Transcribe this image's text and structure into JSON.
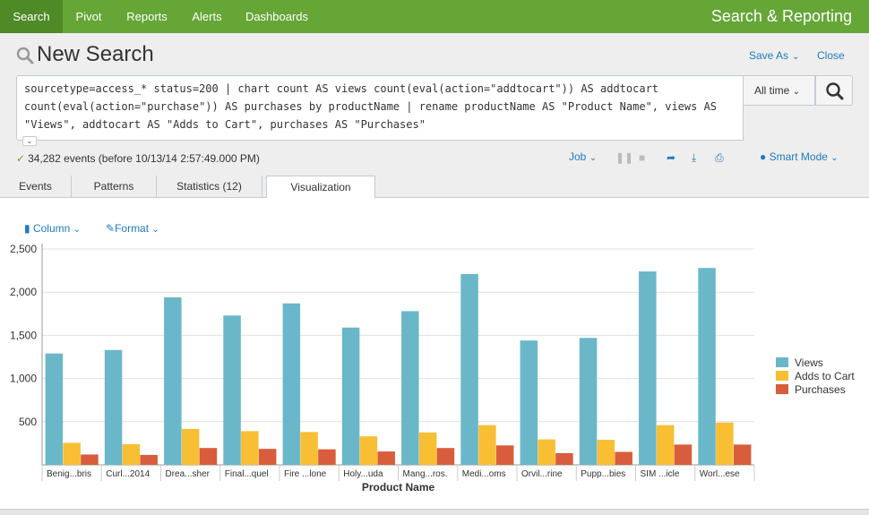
{
  "nav": {
    "items": [
      "Search",
      "Pivot",
      "Reports",
      "Alerts",
      "Dashboards"
    ],
    "active": "Search",
    "app_title": "Search & Reporting"
  },
  "header": {
    "title": "New Search",
    "save_as": "Save As",
    "close": "Close"
  },
  "search": {
    "query": "sourcetype=access_* status=200 | chart count AS views count(eval(action=\"addtocart\")) AS addtocart\ncount(eval(action=\"purchase\")) AS purchases by productName | rename productName AS \"Product Name\", views AS\n\"Views\", addtocart AS \"Adds to Cart\", purchases AS \"Purchases\"",
    "time_range": "All time"
  },
  "status": {
    "events": "34,282 events (before 10/13/14 2:57:49.000 PM)",
    "job": "Job",
    "mode": "Smart Mode"
  },
  "tabs": [
    "Events",
    "Patterns",
    "Statistics (12)",
    "Visualization"
  ],
  "active_tab": "Visualization",
  "viz_controls": {
    "type": "Column",
    "format": "Format"
  },
  "colors": {
    "nav_green": "#65a637",
    "link_blue": "#1e7ac2",
    "views": "#6ab7c9",
    "adds": "#f8be34",
    "purchases": "#d85d3c"
  },
  "chart_data": {
    "type": "bar",
    "categories": [
      "Benig...bris",
      "Curl...2014",
      "Drea...sher",
      "Final...quel",
      "Fire ...lone",
      "Holy...uda",
      "Mang...ros.",
      "Medi...oms",
      "Orvil...rine",
      "Pupp...bies",
      "SIM ...icle",
      "Worl...ese"
    ],
    "series": [
      {
        "name": "Views",
        "values": [
          1290,
          1330,
          1940,
          1730,
          1870,
          1590,
          1780,
          2210,
          1440,
          1470,
          2240,
          2280
        ]
      },
      {
        "name": "Adds to Cart",
        "values": [
          255,
          240,
          415,
          390,
          380,
          330,
          375,
          460,
          295,
          290,
          460,
          490
        ]
      },
      {
        "name": "Purchases",
        "values": [
          120,
          115,
          195,
          185,
          180,
          155,
          195,
          225,
          135,
          150,
          235,
          235
        ]
      }
    ],
    "xlabel": "Product Name",
    "ylabel": "",
    "ylim": [
      0,
      2500
    ],
    "yticks": [
      500,
      1000,
      1500,
      2000,
      2500
    ],
    "ytick_labels": [
      "500",
      "1,000",
      "1,500",
      "2,000",
      "2,500"
    ],
    "grid": true,
    "legend_position": "right"
  }
}
